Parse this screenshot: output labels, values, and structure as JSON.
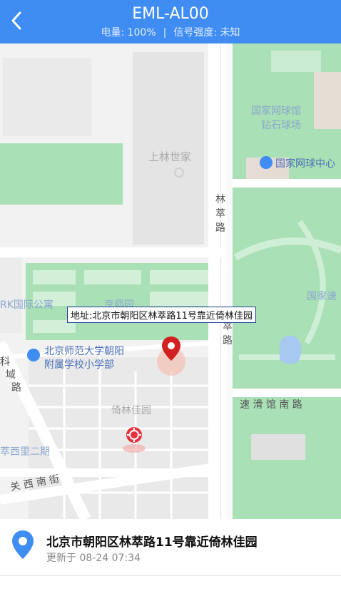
{
  "header": {
    "device_name": "EML-AL00",
    "battery": "电量: 100%",
    "separator": "|",
    "signal": "信号强度: 未知",
    "color": "#3f8cf3"
  },
  "map": {
    "labels": {
      "tennis_line1": "国家网球馆",
      "tennis_line2": "钻石球场",
      "tennis_center": "国家网球中心",
      "shanglin": "上林世家",
      "road_lin": "林",
      "road_cui": "萃",
      "road_lu": "路",
      "road_lin2": "林",
      "road_cui2": "萃",
      "road_lu2": "路",
      "rk": "RK国际公寓",
      "jingshi": "京师园",
      "guojia_su": "国家速",
      "school_line1": "北京师范大学朝阳",
      "school_line2": "附属学校小学部",
      "sulin": "速 滑 馆 南 路",
      "yilin": "倚林佳园",
      "cuixi": "萃西里二期",
      "guanxi": "关 西 南 街",
      "ke": "科",
      "yu": "域",
      "lu3": "路"
    },
    "address_popup": "地址:北京市朝阳区林萃路11号靠近倚林佳园",
    "icons": [
      "poi-school-icon",
      "poi-stadium-icon",
      "location-marker-icon",
      "target-marker-icon"
    ]
  },
  "location_card": {
    "address": "北京市朝阳区林萃路11号靠近倚林佳园",
    "updated": "更新于 08-24 07:34",
    "pin_color": "#3f8cf3"
  }
}
